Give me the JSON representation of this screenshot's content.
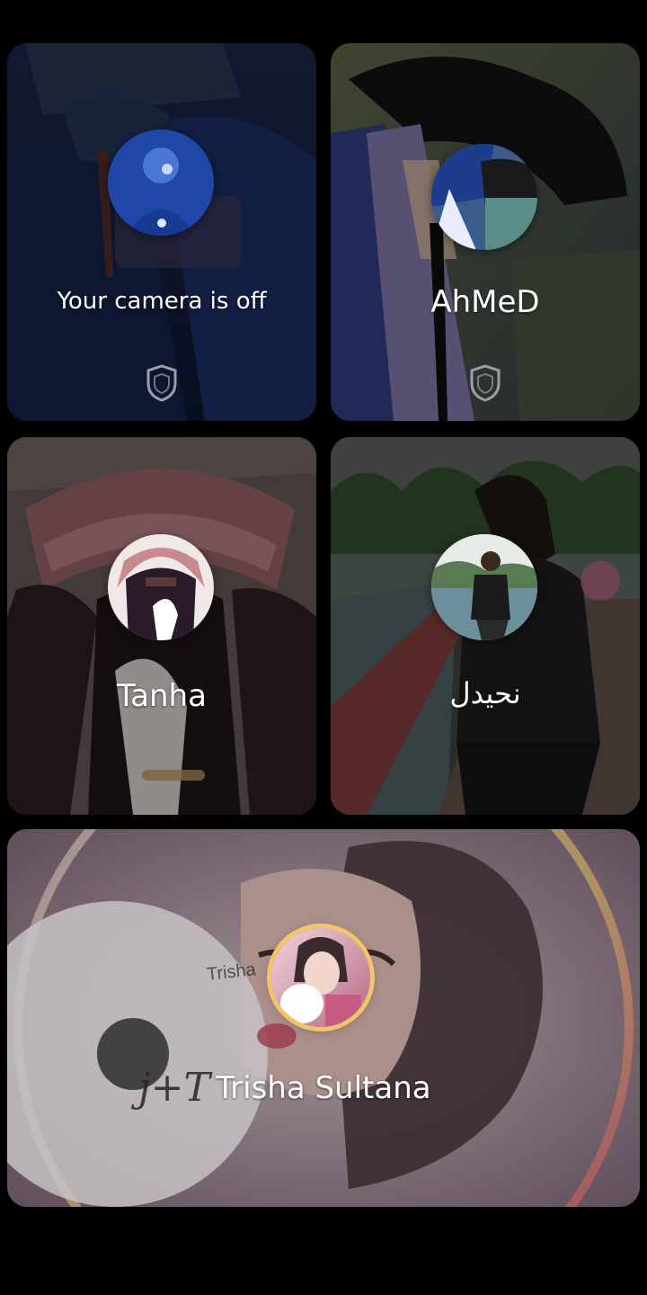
{
  "participants": [
    {
      "id": "self",
      "name": "Your camera is off",
      "shield_icon": "shield-icon"
    },
    {
      "id": "ahmed",
      "name": "AhMeD",
      "shield_icon": "shield-icon"
    },
    {
      "id": "tanha",
      "name": "Tanha"
    },
    {
      "id": "nhydl",
      "name": "نحيدل"
    },
    {
      "id": "trisha",
      "name": "Trisha Sultana",
      "background_text": [
        "Trisha",
        "j+T"
      ]
    }
  ],
  "colors": {
    "background": "#000000",
    "label": "#ffffff",
    "shield": "#9aa0a6"
  }
}
